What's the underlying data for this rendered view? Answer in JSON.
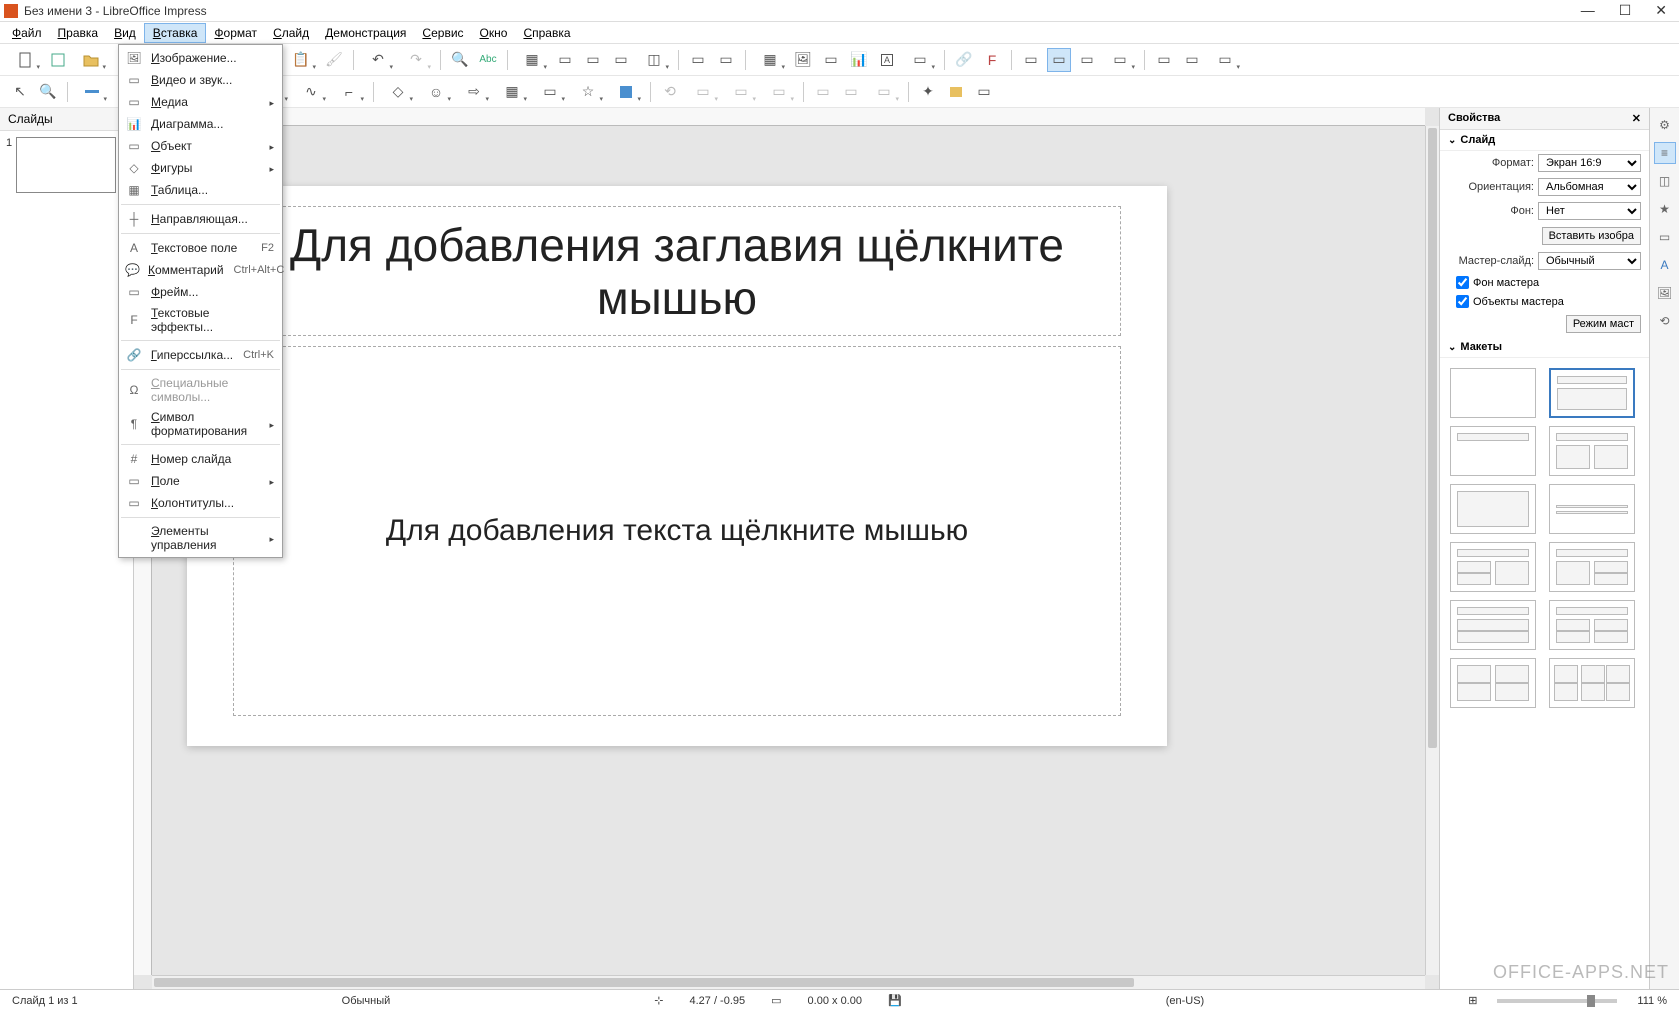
{
  "titlebar": {
    "title": "Без имени 3 - LibreOffice Impress"
  },
  "menubar": {
    "items": [
      "Файл",
      "Правка",
      "Вид",
      "Вставка",
      "Формат",
      "Слайд",
      "Демонстрация",
      "Сервис",
      "Окно",
      "Справка"
    ],
    "active_index": 3
  },
  "dropdown": {
    "items": [
      {
        "label": "Изображение...",
        "icon": "image"
      },
      {
        "label": "Видео и звук...",
        "icon": "media"
      },
      {
        "label": "Медиа",
        "icon": "media",
        "submenu": true
      },
      {
        "label": "Диаграмма...",
        "icon": "chart"
      },
      {
        "label": "Объект",
        "icon": "object",
        "submenu": true
      },
      {
        "label": "Фигуры",
        "icon": "shape",
        "submenu": true
      },
      {
        "label": "Таблица...",
        "icon": "table"
      },
      {
        "sep": true
      },
      {
        "label": "Направляющая...",
        "icon": "guide"
      },
      {
        "sep": true
      },
      {
        "label": "Текстовое поле",
        "icon": "textbox",
        "shortcut": "F2"
      },
      {
        "label": "Комментарий",
        "icon": "comment",
        "shortcut": "Ctrl+Alt+C"
      },
      {
        "label": "Фрейм...",
        "icon": "frame"
      },
      {
        "label": "Текстовые эффекты...",
        "icon": "fontwork"
      },
      {
        "sep": true
      },
      {
        "label": "Гиперссылка...",
        "icon": "link",
        "shortcut": "Ctrl+K"
      },
      {
        "sep": true
      },
      {
        "label": "Специальные символы...",
        "icon": "specialchar",
        "disabled": true
      },
      {
        "label": "Символ форматирования",
        "icon": "mark",
        "submenu": true
      },
      {
        "sep": true
      },
      {
        "label": "Номер слайда",
        "icon": "slidenum"
      },
      {
        "label": "Поле",
        "icon": "field",
        "submenu": true
      },
      {
        "label": "Колонтитулы...",
        "icon": "headerfooter"
      },
      {
        "sep": true
      },
      {
        "label": "Элементы управления",
        "submenu": true
      }
    ]
  },
  "slides_panel": {
    "header": "Слайды",
    "thumbs": [
      {
        "num": "1"
      }
    ]
  },
  "slide": {
    "title_placeholder": "Для добавления заглавия щёлкните мышью",
    "content_placeholder": "Для добавления текста щёлкните мышью"
  },
  "properties": {
    "header": "Свойства",
    "slide_section": "Слайд",
    "format_label": "Формат:",
    "format_value": "Экран 16:9",
    "orientation_label": "Ориентация:",
    "orientation_value": "Альбомная",
    "background_label": "Фон:",
    "background_value": "Нет",
    "insert_image_btn": "Вставить изобра",
    "master_label": "Мастер-слайд:",
    "master_value": "Обычный",
    "cb_master_bg": "Фон мастера",
    "cb_master_objects": "Объекты мастера",
    "master_mode_btn": "Режим маст",
    "layouts_section": "Макеты"
  },
  "statusbar": {
    "slide_of": "Слайд 1 из 1",
    "master": "Обычный",
    "pos": "4.27 / -0.95",
    "size": "0.00 x 0.00",
    "lang": "(en-US)",
    "zoom": "111 %"
  },
  "watermark": "OFFICE-APPS.NET"
}
